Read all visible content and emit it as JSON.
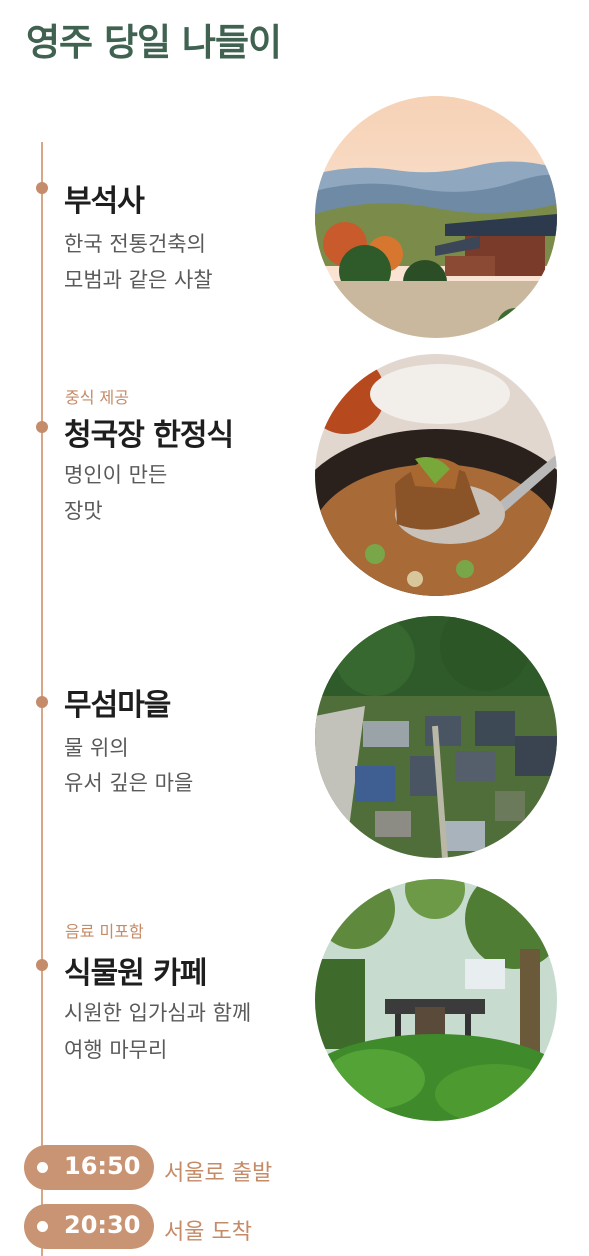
{
  "title": "영주 당일 나들이",
  "stops": [
    {
      "tag": "",
      "name": "부석사",
      "desc": [
        "한국 전통건축의",
        "모범과 같은 사찰"
      ],
      "image": "temple-photo"
    },
    {
      "tag": "중식 제공",
      "name": "청국장 한정식",
      "desc": [
        "명인이 만든",
        "장맛"
      ],
      "image": "cheonggukjang-photo"
    },
    {
      "tag": "",
      "name": "무섬마을",
      "desc": [
        "물 위의",
        "유서 깊은 마을"
      ],
      "image": "village-aerial-photo"
    },
    {
      "tag": "음료 미포함",
      "name": "식물원 카페",
      "desc": [
        "시원한 입가심과 함께",
        "여행 마무리"
      ],
      "image": "botanical-cafe-photo"
    }
  ],
  "schedule": [
    {
      "time": "16:50",
      "label": "서울로 출발"
    },
    {
      "time": "20:30",
      "label": "서울 도착"
    }
  ],
  "colors": {
    "title": "#3f6251",
    "accent": "#c99473",
    "line": "#d6a888"
  }
}
